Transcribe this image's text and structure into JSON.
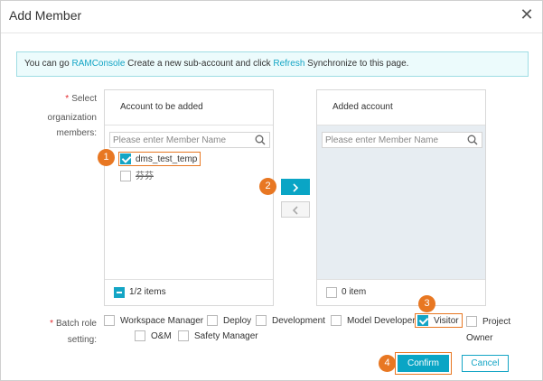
{
  "dialog": {
    "title": "Add Member",
    "close_glyph": "✕"
  },
  "notice": {
    "text_before": "You can go ",
    "link1": "RAMConsole",
    "text_middle": " Create a new sub-account and click ",
    "link2": "Refresh",
    "text_after": " Synchronize to this page."
  },
  "select_members": {
    "required_mark": "*",
    "label_line1": "Select",
    "label_line2": "organization",
    "label_line3": "members:"
  },
  "left_panel": {
    "title": "Account to be added",
    "search_placeholder": "Please enter Member Name",
    "members": [
      {
        "name": "dms_test_temp",
        "checked": true,
        "highlighted": true
      },
      {
        "name": "芬芬",
        "checked": false,
        "highlighted": false
      }
    ],
    "footer_text": "1/2 items",
    "footer_state": "indeterminate"
  },
  "right_panel": {
    "title": "Added account",
    "search_placeholder": "Please enter Member Name",
    "footer_text": "0 item",
    "footer_state": "unchecked"
  },
  "transfer": {
    "move_right_glyph": "chevron-right",
    "move_left_glyph": "chevron-left"
  },
  "batch_role": {
    "required_mark": "*",
    "label_line1": "Batch role",
    "label_line2": "setting:",
    "roles": [
      {
        "label": "Workspace Manager",
        "checked": false
      },
      {
        "label": "Deploy",
        "checked": false
      },
      {
        "label": "Development",
        "checked": false
      },
      {
        "label": "Model Developer",
        "checked": false
      },
      {
        "label": "Visitor",
        "checked": true
      },
      {
        "label": "Project Owner",
        "checked": false
      },
      {
        "label": "O&M",
        "checked": false
      },
      {
        "label": "Safety Manager",
        "checked": false
      }
    ]
  },
  "step_badges": [
    "1",
    "2",
    "3",
    "4"
  ],
  "footer": {
    "confirm_label": "Confirm",
    "cancel_label": "Cancel"
  },
  "colors": {
    "accent": "#0aa5c5",
    "highlight": "#e87722",
    "required": "#e3262b",
    "notice_bg": "#ecfbfc"
  }
}
